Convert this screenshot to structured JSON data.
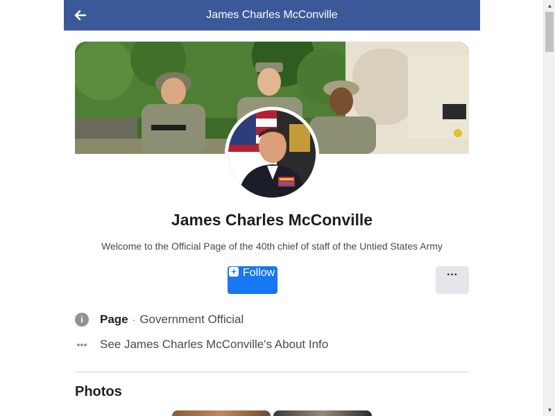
{
  "header": {
    "title": "James Charles McConville"
  },
  "profile": {
    "name": "James Charles McConville",
    "description": "Welcome to the Official Page of the 40th chief of staff of the Untied States Army"
  },
  "actions": {
    "follow_label": "Follow",
    "more_label": "···"
  },
  "info": {
    "page_label": "Page",
    "separator": "·",
    "category": "Government Official",
    "about_link": "See James Charles McConville's About Info"
  },
  "photos": {
    "heading": "Photos"
  },
  "colors": {
    "header_bg": "#3b5998",
    "follow_bg": "#1877f2",
    "more_bg": "#e4e6eb"
  },
  "icons": {
    "back": "arrow-left-icon",
    "info": "info-circle-icon",
    "more": "more-dots-icon"
  }
}
